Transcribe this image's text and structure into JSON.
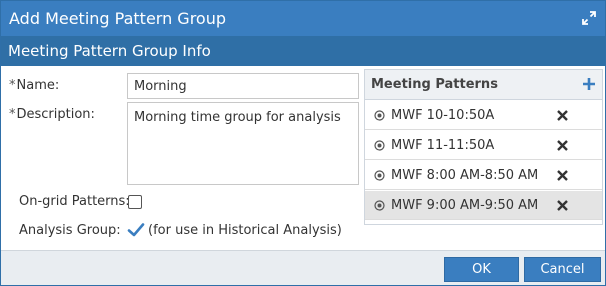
{
  "dialog": {
    "title": "Add Meeting Pattern Group",
    "section_title": "Meeting Pattern Group Info"
  },
  "form": {
    "required_marker": "*",
    "name_label": "Name:",
    "name_value": "Morning",
    "description_label": "Description:",
    "description_value": "Morning time group for analysis",
    "on_grid_label": "On-grid Patterns:",
    "on_grid_checked": false,
    "analysis_group_label": "Analysis Group:",
    "analysis_group_checked": true,
    "analysis_group_note": "(for use in Historical Analysis)"
  },
  "meeting_patterns": {
    "title": "Meeting Patterns",
    "add_icon": "plus-icon",
    "items": [
      {
        "label": "MWF 10-10:50A",
        "selected": false
      },
      {
        "label": "MWF 11-11:50A",
        "selected": false
      },
      {
        "label": "MWF 8:00 AM-8:50 AM",
        "selected": false
      },
      {
        "label": "MWF 9:00 AM-9:50 AM",
        "selected": true
      }
    ]
  },
  "buttons": {
    "ok": "OK",
    "cancel": "Cancel"
  },
  "colors": {
    "titlebar": "#3a7ec0",
    "section_header": "#2f6fa6",
    "accent": "#3a7ec0",
    "selected_row": "#e4e4e4",
    "footer": "#e9edf1"
  }
}
